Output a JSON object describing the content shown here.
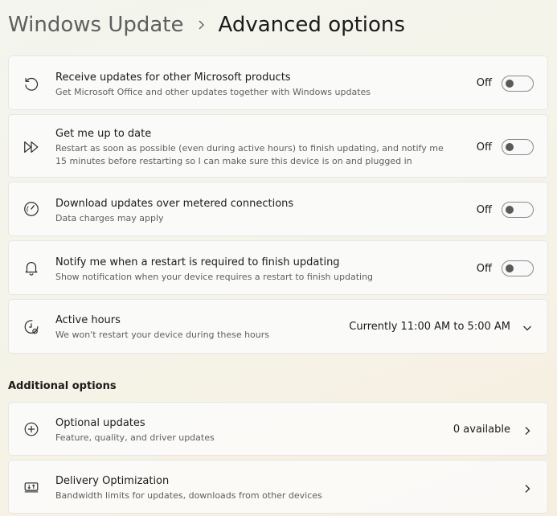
{
  "breadcrumb": {
    "parent": "Windows Update",
    "separator": "›",
    "current": "Advanced options"
  },
  "settings": [
    {
      "title": "Receive updates for other Microsoft products",
      "description": "Get Microsoft Office and other updates together with Windows updates",
      "state": "Off",
      "icon": "refresh-icon"
    },
    {
      "title": "Get me up to date",
      "description": "Restart as soon as possible (even during active hours) to finish updating, and notify me 15 minutes before restarting so I can make sure this device is on and plugged in",
      "state": "Off",
      "icon": "fast-forward-icon"
    },
    {
      "title": "Download updates over metered connections",
      "description": "Data charges may apply",
      "state": "Off",
      "icon": "speedometer-icon"
    },
    {
      "title": "Notify me when a restart is required to finish updating",
      "description": "Show notification when your device requires a restart to finish updating",
      "state": "Off",
      "icon": "bell-icon"
    }
  ],
  "active_hours": {
    "title": "Active hours",
    "description": "We won't restart your device during these hours",
    "value": "Currently 11:00 AM to 5:00 AM",
    "icon": "clock-settings-icon"
  },
  "additional": {
    "section_title": "Additional options",
    "optional_updates": {
      "title": "Optional updates",
      "description": "Feature, quality, and driver updates",
      "value": "0 available",
      "icon": "plus-circle-icon"
    },
    "delivery_optimization": {
      "title": "Delivery Optimization",
      "description": "Bandwidth limits for updates, downloads from other devices",
      "icon": "delivery-optimization-icon"
    }
  },
  "colors": {
    "text_primary": "#1b1b1b",
    "text_secondary": "#5f5f5f",
    "card_bg": "#fbfbfb",
    "card_border": "#e6e6e6"
  }
}
